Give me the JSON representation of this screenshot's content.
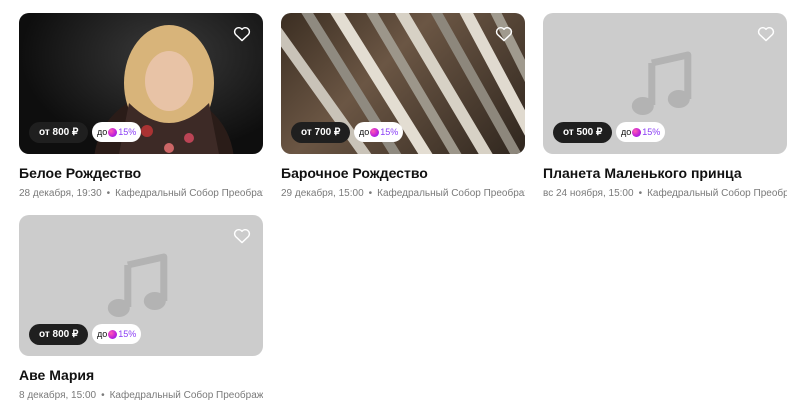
{
  "cards": [
    {
      "title": "Белое Рождество",
      "price": "от 800 ₽",
      "promo_prefix": "до",
      "promo_percent": "15%",
      "date": "28 декабря, 19:30",
      "venue": "Кафедральный Собор Преображени...",
      "image": "photo-portrait"
    },
    {
      "title": "Барочное Рождество",
      "price": "от 700 ₽",
      "promo_prefix": "до",
      "promo_percent": "15%",
      "date": "29 декабря, 15:00",
      "venue": "Кафедральный Собор Преображени...",
      "image": "photo-organ-pipes"
    },
    {
      "title": "Планета Маленького принца",
      "price": "от 500 ₽",
      "promo_prefix": "до",
      "promo_percent": "15%",
      "date": "вс 24 ноября, 15:00",
      "venue": "Кафедральный Собор Преображени...",
      "image": "music-note-placeholder-icon"
    },
    {
      "title": "Аве Мария",
      "price": "от 800 ₽",
      "promo_prefix": "до",
      "promo_percent": "15%",
      "date": "8 декабря, 15:00",
      "venue": "Кафедральный Собор Преображени...",
      "image": "music-note-placeholder-icon"
    }
  ],
  "separator": "•",
  "colors": {
    "price_bg": "#1f1f1f",
    "placeholder_bg": "#cccccc",
    "promo_accent": "#8a3df5"
  }
}
